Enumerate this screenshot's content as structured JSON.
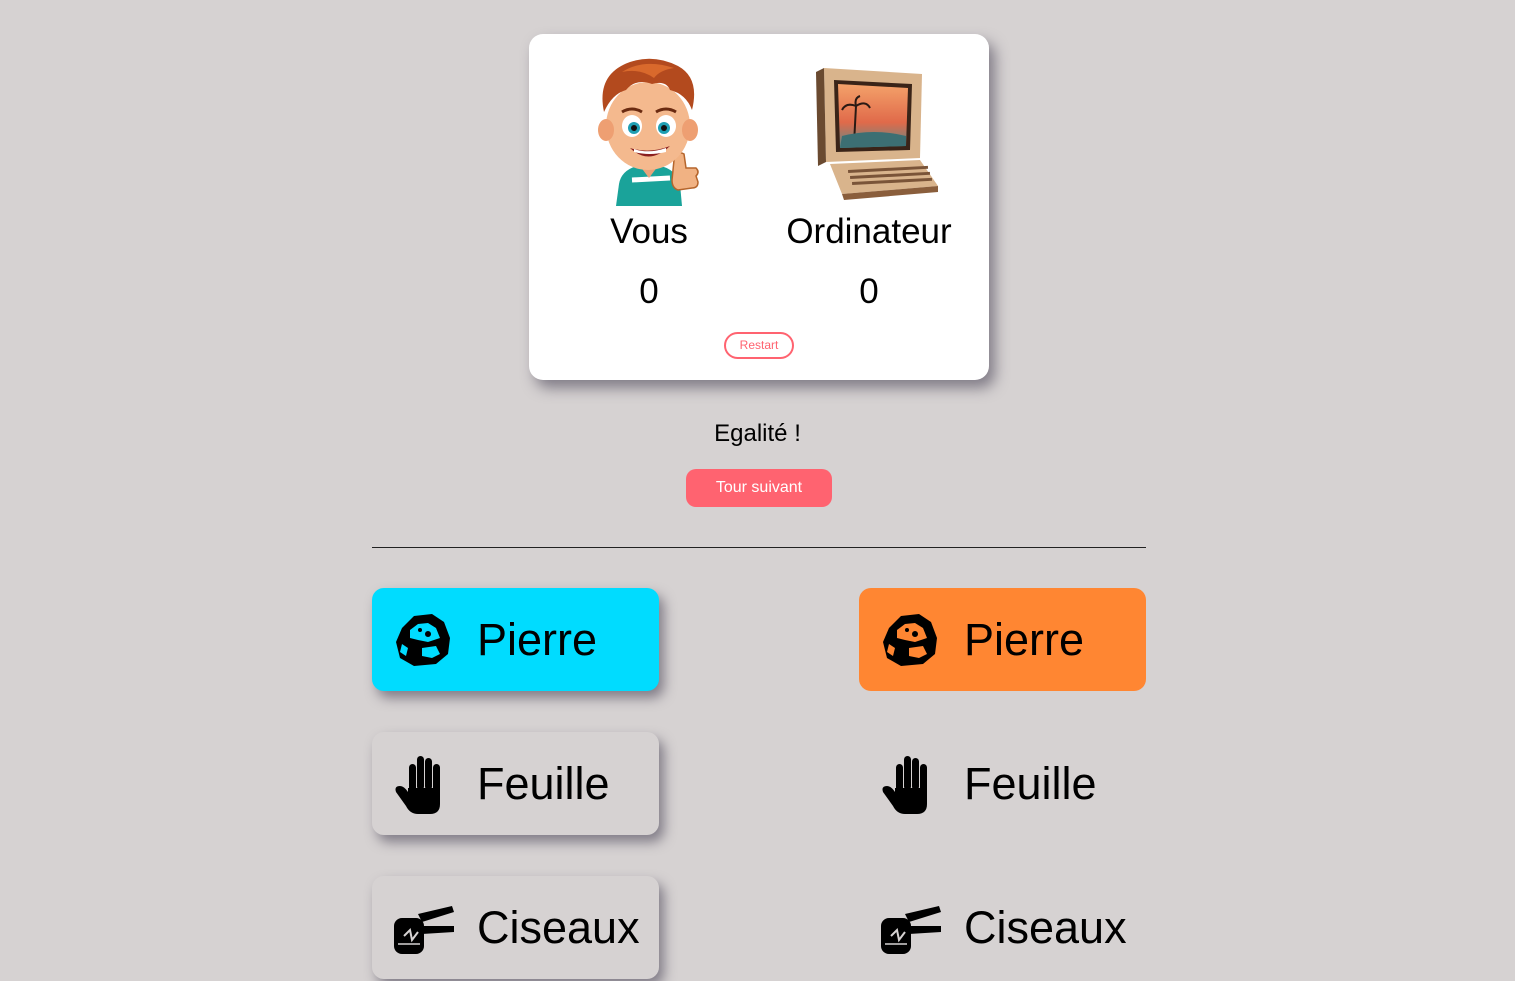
{
  "scoreboard": {
    "player": {
      "name": "Vous",
      "score": "0",
      "avatar_icon": "boy-avatar"
    },
    "computer": {
      "name": "Ordinateur",
      "score": "0",
      "avatar_icon": "retro-computer"
    },
    "restart_label": "Restart"
  },
  "round": {
    "result": "Egalité !",
    "next_label": "Tour suivant"
  },
  "choices": {
    "player": [
      {
        "label": "Pierre",
        "icon": "rock-icon",
        "selected": true
      },
      {
        "label": "Feuille",
        "icon": "hand-icon",
        "selected": false
      },
      {
        "label": "Ciseaux",
        "icon": "scissors-hand-icon",
        "selected": false
      }
    ],
    "computer": [
      {
        "label": "Pierre",
        "icon": "rock-icon",
        "selected": true
      },
      {
        "label": "Feuille",
        "icon": "hand-icon",
        "selected": false
      },
      {
        "label": "Ciseaux",
        "icon": "scissors-hand-icon",
        "selected": false
      }
    ]
  },
  "colors": {
    "background": "#d6d2d2",
    "accent": "#ff6370",
    "player_selected": "#00dcff",
    "computer_selected": "#ff8632"
  }
}
